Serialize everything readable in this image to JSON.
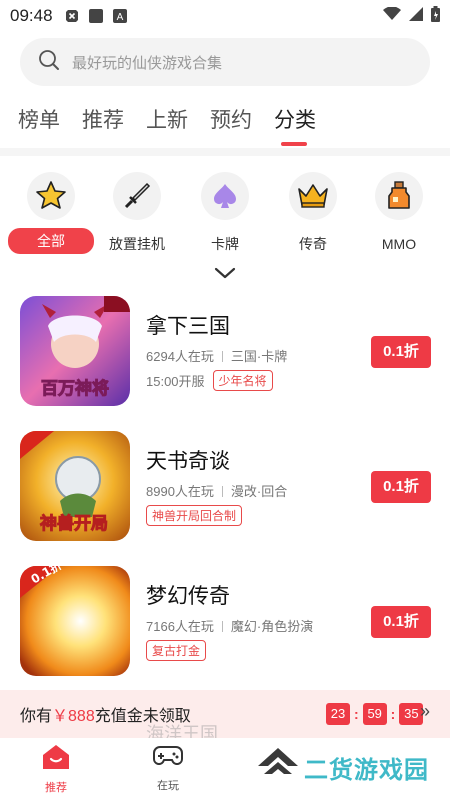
{
  "status_bar": {
    "time": "09:48"
  },
  "search": {
    "placeholder": "最好玩的仙侠游戏合集"
  },
  "tabs": [
    {
      "label": "榜单"
    },
    {
      "label": "推荐"
    },
    {
      "label": "上新"
    },
    {
      "label": "预约"
    },
    {
      "label": "分类",
      "active": true
    }
  ],
  "categories": [
    {
      "label": "全部",
      "icon": "star-icon",
      "active": true
    },
    {
      "label": "放置挂机",
      "icon": "sword-icon"
    },
    {
      "label": "卡牌",
      "icon": "spade-card-icon"
    },
    {
      "label": "传奇",
      "icon": "crown-icon"
    },
    {
      "label": "MMO",
      "icon": "potion-icon"
    }
  ],
  "games": [
    {
      "name": "拿下三国",
      "players": "6294人在玩",
      "genre": "三国·卡牌",
      "open": "15:00开服",
      "tag": "少年名将",
      "discount": "0.1折",
      "cover_text": "百万神将"
    },
    {
      "name": "天书奇谈",
      "players": "8990人在玩",
      "genre": "漫改·回合",
      "open": "",
      "tag": "神兽开局回合制",
      "discount": "0.1折",
      "cover_text": "神兽开局"
    },
    {
      "name": "梦幻传奇",
      "players": "7166人在玩",
      "genre": "魔幻·角色扮演",
      "open": "",
      "tag": "复古打金",
      "discount": "0.1折",
      "cover_text": "0.1折"
    }
  ],
  "recharge": {
    "prefix": "你有",
    "amount": "￥888",
    "suffix": "充值金未领取",
    "ghost_text": "海洋王国",
    "timer": [
      "23",
      "59",
      "35"
    ],
    "more": "»"
  },
  "bottom_nav": [
    {
      "label": "推荐",
      "icon": "home-icon",
      "active": true
    },
    {
      "label": "在玩",
      "icon": "gamepad-icon"
    }
  ],
  "watermark": {
    "text": "二货游戏园"
  },
  "colors": {
    "accent": "#ee3a45",
    "watermark": "#3fb9c8"
  }
}
